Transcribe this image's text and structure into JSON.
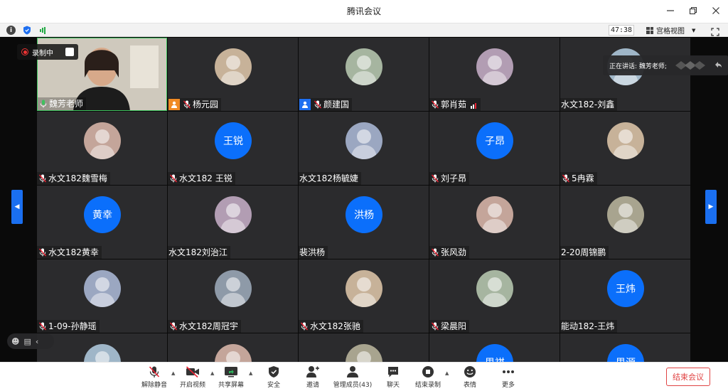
{
  "window": {
    "title": "腾讯会议",
    "minimize_icon": "minimize-icon",
    "restore_icon": "restore-icon",
    "close_icon": "close-icon"
  },
  "infobar": {
    "timer": "47:38",
    "view_label": "宫格视图"
  },
  "recording": {
    "label": "录制中"
  },
  "speaking": {
    "label": "正在讲话: 魏芳老师;"
  },
  "participants": [
    {
      "name": "魏芳老师",
      "kind": "video",
      "mic": "active"
    },
    {
      "name": "杨元园",
      "kind": "photo",
      "badge": "orange",
      "mic": "muted"
    },
    {
      "name": "颜建国",
      "kind": "photo",
      "badge": "blue",
      "mic": "muted"
    },
    {
      "name": "郭肖茹",
      "kind": "photo",
      "mic": "muted",
      "signal": true
    },
    {
      "name": "水文182-刘鑫",
      "kind": "photo",
      "mic": "none"
    },
    {
      "name": "水文182魏雪梅",
      "kind": "photo",
      "mic": "muted"
    },
    {
      "name": "水文182 王锐",
      "kind": "initials",
      "initials": "王锐",
      "mic": "muted"
    },
    {
      "name": "水文182杨毓婕",
      "kind": "photo",
      "mic": "none"
    },
    {
      "name": "刘子昂",
      "kind": "initials",
      "initials": "子昂",
      "mic": "muted"
    },
    {
      "name": "5冉霖",
      "kind": "photo",
      "mic": "muted"
    },
    {
      "name": "水文182黄幸",
      "kind": "initials",
      "initials": "黄幸",
      "mic": "muted"
    },
    {
      "name": "水文182刘治江",
      "kind": "photo",
      "mic": "none"
    },
    {
      "name": "裴洪杨",
      "kind": "initials",
      "initials": "洪杨",
      "mic": "none"
    },
    {
      "name": "张风劲",
      "kind": "photo",
      "mic": "muted"
    },
    {
      "name": "2-20周锦鹏",
      "kind": "photo",
      "mic": "none"
    },
    {
      "name": "1-09-孙静瑶",
      "kind": "photo",
      "mic": "muted"
    },
    {
      "name": "水文182周冠宇",
      "kind": "photo",
      "mic": "muted"
    },
    {
      "name": "水文182张驰",
      "kind": "photo",
      "mic": "muted"
    },
    {
      "name": "梁晨阳",
      "kind": "photo",
      "mic": "muted"
    },
    {
      "name": "能动182-王炜",
      "kind": "initials",
      "initials": "王炜",
      "mic": "none"
    },
    {
      "name": "",
      "kind": "photo",
      "mic": "none"
    },
    {
      "name": "",
      "kind": "photo",
      "mic": "none"
    },
    {
      "name": "",
      "kind": "photo",
      "mic": "none"
    },
    {
      "name": "",
      "kind": "initials",
      "initials": "思祺",
      "mic": "none"
    },
    {
      "name": "",
      "kind": "initials",
      "initials": "思源",
      "mic": "none"
    }
  ],
  "toolbar": {
    "unmute": "解除静音",
    "start_video": "开启视频",
    "share_screen": "共享屏幕",
    "security": "安全",
    "invite": "邀请",
    "manage_members": "管理成员(43)",
    "chat": "聊天",
    "end_recording": "结束录制",
    "reactions": "表情",
    "more": "更多",
    "end_meeting": "结束会议"
  }
}
